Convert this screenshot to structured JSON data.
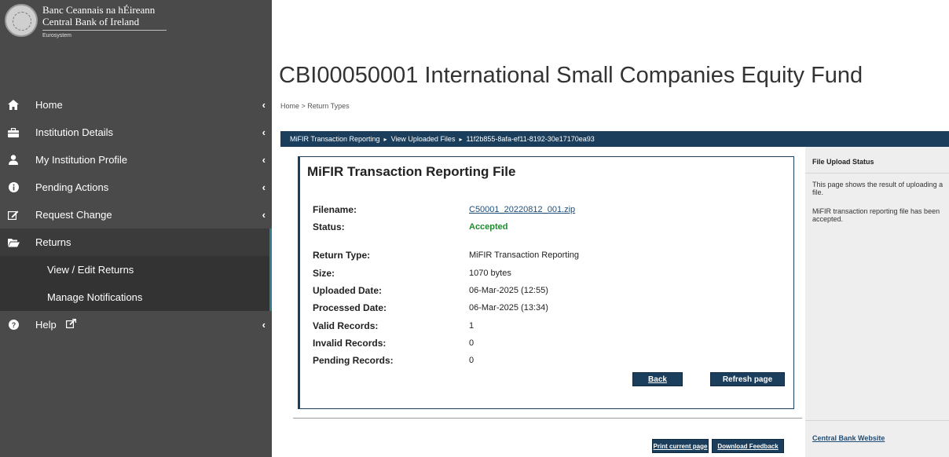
{
  "logo": {
    "line1": "Banc Ceannais na hÉireann",
    "line2": "Central Bank of Ireland",
    "line3": "Eurosystem"
  },
  "sidebar": {
    "items": [
      {
        "label": "Home",
        "icon": "home-icon"
      },
      {
        "label": "Institution Details",
        "icon": "briefcase-icon"
      },
      {
        "label": "My Institution Profile",
        "icon": "user-icon"
      },
      {
        "label": "Pending Actions",
        "icon": "info-icon"
      },
      {
        "label": "Request Change",
        "icon": "edit-icon"
      },
      {
        "label": "Returns",
        "icon": "folder-open-icon"
      },
      {
        "label": "Help",
        "icon": "question-icon"
      }
    ],
    "returns_sub": [
      "View / Edit Returns",
      "Manage Notifications"
    ]
  },
  "page": {
    "title": "CBI00050001 International Small Companies Equity Fund",
    "breadcrumb_home": "Home",
    "breadcrumb_sep": " > ",
    "breadcrumb_current": "Return Types"
  },
  "crumbbar": {
    "part1": "MiFIR Transaction Reporting",
    "part2": "View Uploaded Files",
    "part3": "11f2b855-8afa-ef11-8192-30e17170ea93"
  },
  "card": {
    "title": "MiFIR Transaction Reporting File",
    "filename_label": "Filename:",
    "filename_value": "C50001_20220812_001.zip",
    "status_label": "Status:",
    "status_value": "Accepted",
    "return_type_label": "Return Type:",
    "return_type_value": "MiFIR Transaction Reporting",
    "size_label": "Size:",
    "size_value": "1070 bytes",
    "uploaded_label": "Uploaded Date:",
    "uploaded_value": "06-Mar-2025 (12:55)",
    "processed_label": "Processed Date:",
    "processed_value": "06-Mar-2025 (13:34)",
    "valid_label": "Valid Records:",
    "valid_value": "1",
    "invalid_label": "Invalid Records:",
    "invalid_value": "0",
    "pending_label": "Pending Records:",
    "pending_value": "0",
    "back_label": "Back",
    "refresh_label": "Refresh page"
  },
  "footer_buttons": {
    "print_label": "Print current page",
    "download_label": "Download Feedback"
  },
  "side_panel": {
    "heading": "File Upload Status",
    "text1": "This page shows the result of uploading a file.",
    "text2": "MiFIR transaction reporting file has been accepted.",
    "link": "Central Bank Website"
  },
  "colors": {
    "sidebar_bg": "#4a4a4a",
    "navy": "#1a3e5c",
    "accent_teal": "#2d7d8f",
    "status_green": "#1e8a2e"
  }
}
